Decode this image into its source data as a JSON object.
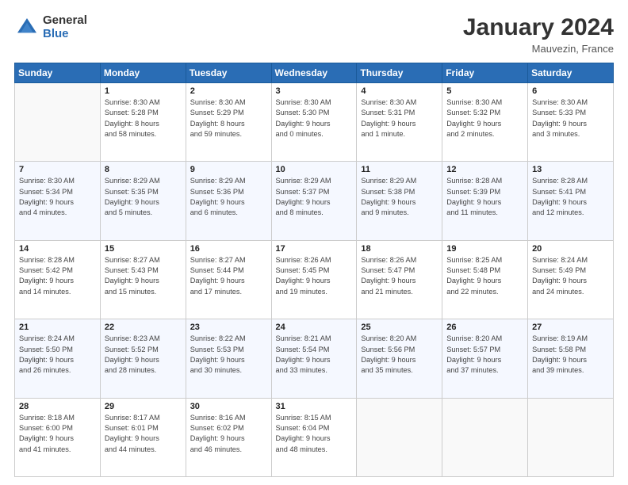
{
  "header": {
    "logo_general": "General",
    "logo_blue": "Blue",
    "month_title": "January 2024",
    "location": "Mauvezin, France"
  },
  "days_of_week": [
    "Sunday",
    "Monday",
    "Tuesday",
    "Wednesday",
    "Thursday",
    "Friday",
    "Saturday"
  ],
  "weeks": [
    [
      {
        "day": "",
        "info": ""
      },
      {
        "day": "1",
        "info": "Sunrise: 8:30 AM\nSunset: 5:28 PM\nDaylight: 8 hours\nand 58 minutes."
      },
      {
        "day": "2",
        "info": "Sunrise: 8:30 AM\nSunset: 5:29 PM\nDaylight: 8 hours\nand 59 minutes."
      },
      {
        "day": "3",
        "info": "Sunrise: 8:30 AM\nSunset: 5:30 PM\nDaylight: 9 hours\nand 0 minutes."
      },
      {
        "day": "4",
        "info": "Sunrise: 8:30 AM\nSunset: 5:31 PM\nDaylight: 9 hours\nand 1 minute."
      },
      {
        "day": "5",
        "info": "Sunrise: 8:30 AM\nSunset: 5:32 PM\nDaylight: 9 hours\nand 2 minutes."
      },
      {
        "day": "6",
        "info": "Sunrise: 8:30 AM\nSunset: 5:33 PM\nDaylight: 9 hours\nand 3 minutes."
      }
    ],
    [
      {
        "day": "7",
        "info": "Sunrise: 8:30 AM\nSunset: 5:34 PM\nDaylight: 9 hours\nand 4 minutes."
      },
      {
        "day": "8",
        "info": "Sunrise: 8:29 AM\nSunset: 5:35 PM\nDaylight: 9 hours\nand 5 minutes."
      },
      {
        "day": "9",
        "info": "Sunrise: 8:29 AM\nSunset: 5:36 PM\nDaylight: 9 hours\nand 6 minutes."
      },
      {
        "day": "10",
        "info": "Sunrise: 8:29 AM\nSunset: 5:37 PM\nDaylight: 9 hours\nand 8 minutes."
      },
      {
        "day": "11",
        "info": "Sunrise: 8:29 AM\nSunset: 5:38 PM\nDaylight: 9 hours\nand 9 minutes."
      },
      {
        "day": "12",
        "info": "Sunrise: 8:28 AM\nSunset: 5:39 PM\nDaylight: 9 hours\nand 11 minutes."
      },
      {
        "day": "13",
        "info": "Sunrise: 8:28 AM\nSunset: 5:41 PM\nDaylight: 9 hours\nand 12 minutes."
      }
    ],
    [
      {
        "day": "14",
        "info": "Sunrise: 8:28 AM\nSunset: 5:42 PM\nDaylight: 9 hours\nand 14 minutes."
      },
      {
        "day": "15",
        "info": "Sunrise: 8:27 AM\nSunset: 5:43 PM\nDaylight: 9 hours\nand 15 minutes."
      },
      {
        "day": "16",
        "info": "Sunrise: 8:27 AM\nSunset: 5:44 PM\nDaylight: 9 hours\nand 17 minutes."
      },
      {
        "day": "17",
        "info": "Sunrise: 8:26 AM\nSunset: 5:45 PM\nDaylight: 9 hours\nand 19 minutes."
      },
      {
        "day": "18",
        "info": "Sunrise: 8:26 AM\nSunset: 5:47 PM\nDaylight: 9 hours\nand 21 minutes."
      },
      {
        "day": "19",
        "info": "Sunrise: 8:25 AM\nSunset: 5:48 PM\nDaylight: 9 hours\nand 22 minutes."
      },
      {
        "day": "20",
        "info": "Sunrise: 8:24 AM\nSunset: 5:49 PM\nDaylight: 9 hours\nand 24 minutes."
      }
    ],
    [
      {
        "day": "21",
        "info": "Sunrise: 8:24 AM\nSunset: 5:50 PM\nDaylight: 9 hours\nand 26 minutes."
      },
      {
        "day": "22",
        "info": "Sunrise: 8:23 AM\nSunset: 5:52 PM\nDaylight: 9 hours\nand 28 minutes."
      },
      {
        "day": "23",
        "info": "Sunrise: 8:22 AM\nSunset: 5:53 PM\nDaylight: 9 hours\nand 30 minutes."
      },
      {
        "day": "24",
        "info": "Sunrise: 8:21 AM\nSunset: 5:54 PM\nDaylight: 9 hours\nand 33 minutes."
      },
      {
        "day": "25",
        "info": "Sunrise: 8:20 AM\nSunset: 5:56 PM\nDaylight: 9 hours\nand 35 minutes."
      },
      {
        "day": "26",
        "info": "Sunrise: 8:20 AM\nSunset: 5:57 PM\nDaylight: 9 hours\nand 37 minutes."
      },
      {
        "day": "27",
        "info": "Sunrise: 8:19 AM\nSunset: 5:58 PM\nDaylight: 9 hours\nand 39 minutes."
      }
    ],
    [
      {
        "day": "28",
        "info": "Sunrise: 8:18 AM\nSunset: 6:00 PM\nDaylight: 9 hours\nand 41 minutes."
      },
      {
        "day": "29",
        "info": "Sunrise: 8:17 AM\nSunset: 6:01 PM\nDaylight: 9 hours\nand 44 minutes."
      },
      {
        "day": "30",
        "info": "Sunrise: 8:16 AM\nSunset: 6:02 PM\nDaylight: 9 hours\nand 46 minutes."
      },
      {
        "day": "31",
        "info": "Sunrise: 8:15 AM\nSunset: 6:04 PM\nDaylight: 9 hours\nand 48 minutes."
      },
      {
        "day": "",
        "info": ""
      },
      {
        "day": "",
        "info": ""
      },
      {
        "day": "",
        "info": ""
      }
    ]
  ]
}
